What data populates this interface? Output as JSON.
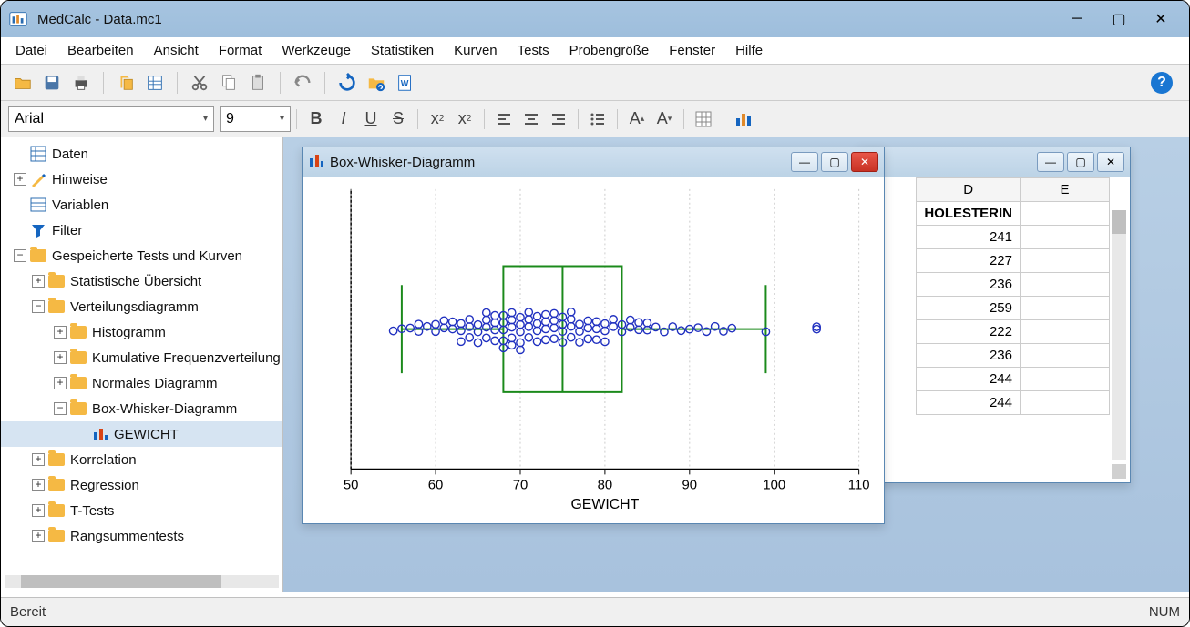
{
  "app": {
    "title": "MedCalc - Data.mc1"
  },
  "menu": {
    "items": [
      "Datei",
      "Bearbeiten",
      "Ansicht",
      "Format",
      "Werkzeuge",
      "Statistiken",
      "Kurven",
      "Tests",
      "Probengröße",
      "Fenster",
      "Hilfe"
    ]
  },
  "fmt": {
    "font": "Arial",
    "size": "9"
  },
  "tree": {
    "n0": "Daten",
    "n1": "Hinweise",
    "n2": "Variablen",
    "n3": "Filter",
    "n4": "Gespeicherte Tests und Kurven",
    "n5": "Statistische Übersicht",
    "n6": "Verteilungsdiagramm",
    "n7": "Histogramm",
    "n8": "Kumulative Frequenzverteilung",
    "n9": "Normales Diagramm",
    "n10": "Box-Whisker-Diagramm",
    "n11": "GEWICHT",
    "n12": "Korrelation",
    "n13": "Regression",
    "n14": "T-Tests",
    "n15": "Rangsummentests"
  },
  "chart_window": {
    "title": "Box-Whisker-Diagramm"
  },
  "chart_data": {
    "type": "boxplot-horizontal-with-points",
    "xlabel": "GEWICHT",
    "xlim": [
      50,
      110
    ],
    "xticks": [
      50,
      60,
      70,
      80,
      90,
      100,
      110
    ],
    "box": {
      "q1": 68,
      "median": 75,
      "q3": 82,
      "whisker_low": 56,
      "whisker_high": 99
    },
    "outliers": [
      105
    ],
    "points": [
      55,
      56,
      57,
      58,
      58,
      59,
      60,
      60,
      61,
      61,
      62,
      62,
      63,
      63,
      63,
      64,
      64,
      64,
      65,
      65,
      65,
      66,
      66,
      66,
      66,
      67,
      67,
      67,
      67,
      68,
      68,
      68,
      68,
      68,
      69,
      69,
      69,
      69,
      69,
      70,
      70,
      70,
      70,
      70,
      71,
      71,
      71,
      71,
      72,
      72,
      72,
      72,
      73,
      73,
      73,
      73,
      74,
      74,
      74,
      74,
      75,
      75,
      75,
      75,
      76,
      76,
      76,
      76,
      77,
      77,
      77,
      78,
      78,
      78,
      79,
      79,
      79,
      80,
      80,
      80,
      81,
      81,
      82,
      82,
      83,
      83,
      84,
      84,
      85,
      85,
      86,
      87,
      88,
      89,
      90,
      91,
      92,
      93,
      94,
      95,
      99,
      105
    ]
  },
  "grid": {
    "columns": [
      "D",
      "E"
    ],
    "header_row": [
      "HOLESTERIN",
      ""
    ],
    "rows": [
      [
        "241",
        ""
      ],
      [
        "227",
        ""
      ],
      [
        "236",
        ""
      ],
      [
        "259",
        ""
      ],
      [
        "222",
        ""
      ],
      [
        "236",
        ""
      ],
      [
        "244",
        ""
      ],
      [
        "244",
        ""
      ]
    ]
  },
  "status": {
    "text": "Bereit",
    "num": "NUM"
  }
}
